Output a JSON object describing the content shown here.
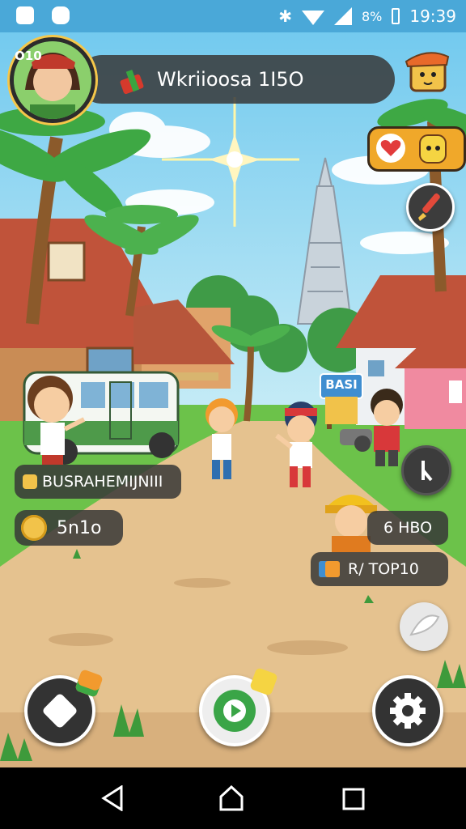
{
  "status_bar": {
    "battery": "8%",
    "time": "19:39"
  },
  "player": {
    "name": "Wkriioosa 1I5O",
    "avatar_badge": "O10"
  },
  "labels": {
    "npc_label": "BUSRAHEMIJNIII",
    "coins": "5n1o",
    "score": "6 HBO",
    "top": "R/ TOP10",
    "sign": "BASI"
  },
  "colors": {
    "sky": "#8fd3f0",
    "path": "#e5c28f",
    "grass": "#6cc24a",
    "pill_bg": "#373737",
    "accent_orange": "#f29a2e",
    "status_bar": "#4aa8d8"
  },
  "icons": [
    "bluetooth-icon",
    "wifi-icon",
    "signal-icon",
    "heart-icon",
    "brush-icon",
    "timer-icon",
    "card-icon",
    "chat-icon",
    "settings-icon",
    "back-icon",
    "home-icon",
    "recents-icon"
  ]
}
